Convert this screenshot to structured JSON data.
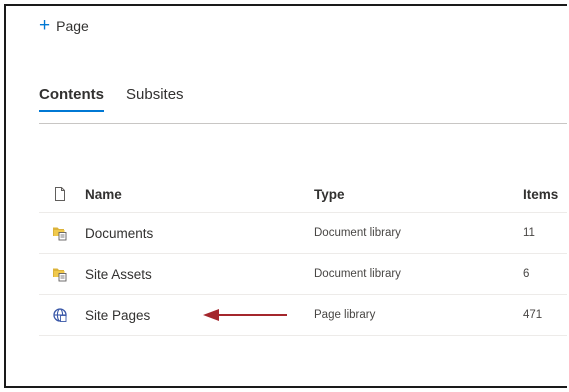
{
  "toolbar": {
    "new_page_label": "Page"
  },
  "tabs": [
    {
      "label": "Contents",
      "active": true
    },
    {
      "label": "Subsites",
      "active": false
    }
  ],
  "table": {
    "columns": {
      "name": "Name",
      "type": "Type",
      "items": "Items"
    },
    "rows": [
      {
        "name": "Documents",
        "type": "Document library",
        "items": "11",
        "icon": "document-library-icon"
      },
      {
        "name": "Site Assets",
        "type": "Document library",
        "items": "6",
        "icon": "document-library-icon"
      },
      {
        "name": "Site Pages",
        "type": "Page library",
        "items": "471",
        "icon": "page-library-icon"
      }
    ]
  },
  "colors": {
    "accent": "#0078d4",
    "folder": "#c19c00",
    "arrow": "#a4262c"
  }
}
